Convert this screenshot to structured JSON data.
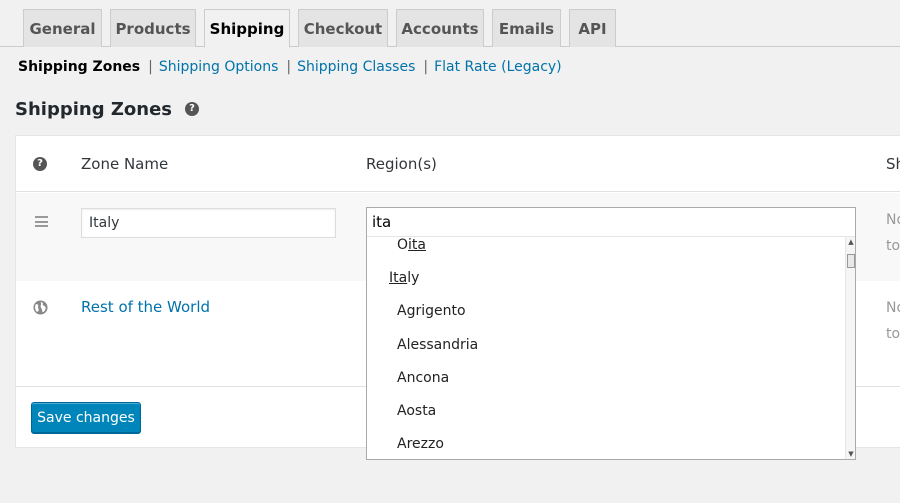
{
  "tabs": [
    {
      "label": "General"
    },
    {
      "label": "Products"
    },
    {
      "label": "Shipping"
    },
    {
      "label": "Checkout"
    },
    {
      "label": "Accounts"
    },
    {
      "label": "Emails"
    },
    {
      "label": "API"
    }
  ],
  "active_tab": "Shipping",
  "subnav": {
    "current": "Shipping Zones",
    "links": [
      "Shipping Options",
      "Shipping Classes",
      "Flat Rate (Legacy)"
    ],
    "separator": "|"
  },
  "page": {
    "title": "Shipping Zones",
    "help_icon": "?"
  },
  "table": {
    "columns": {
      "help": "?",
      "zone_name": "Zone Name",
      "regions": "Region(s)",
      "methods_truncated": "Sh"
    },
    "rows": [
      {
        "zone_name": "Italy",
        "truncated_l1": "No",
        "truncated_l2": "to"
      },
      {
        "zone_name": "Rest of the World",
        "truncated_l1": "No",
        "truncated_l2": "to"
      }
    ]
  },
  "region_selector": {
    "search_value": "ita",
    "options": [
      {
        "text": "Oita",
        "match_start": 1,
        "match_end": 4,
        "indent": true
      },
      {
        "text": "Italy",
        "match_start": 0,
        "match_end": 3,
        "indent": false
      },
      {
        "text": "Agrigento",
        "indent": true
      },
      {
        "text": "Alessandria",
        "indent": true
      },
      {
        "text": "Ancona",
        "indent": true
      },
      {
        "text": "Aosta",
        "indent": true
      },
      {
        "text": "Arezzo",
        "indent": true
      }
    ],
    "scroll_up_glyph": "▲",
    "scroll_down_glyph": "▼"
  },
  "actions": {
    "save_label": "Save changes"
  },
  "icons": {
    "drag": "menu-icon",
    "globe": "globe-icon",
    "help": "help-icon"
  },
  "colors": {
    "link": "#0073aa",
    "primary_button": "#0085ba",
    "background": "#f1f1f1"
  }
}
